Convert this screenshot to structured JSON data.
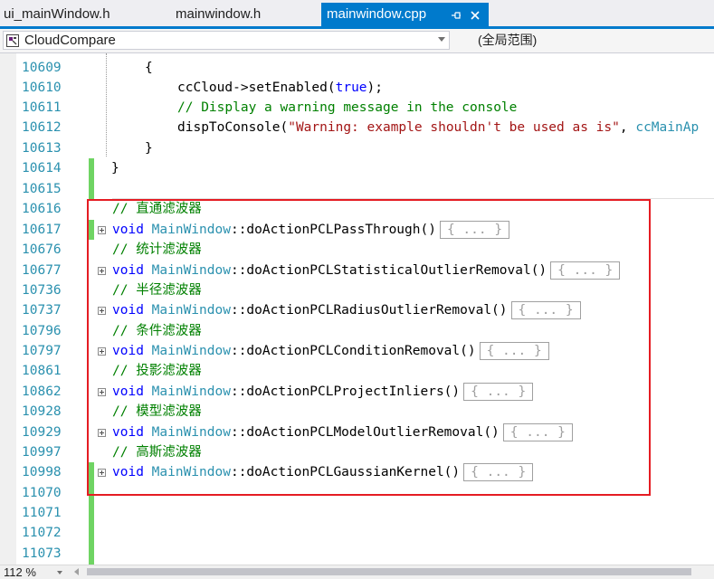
{
  "tabs": [
    {
      "label": "ui_mainWindow.h",
      "active": false
    },
    {
      "label": "mainwindow.h",
      "active": false
    },
    {
      "label": "mainwindow.cpp",
      "active": true
    }
  ],
  "tab_icons": {
    "pin": "pin-icon",
    "close": "close-icon"
  },
  "nav": {
    "scope": "CloudCompare",
    "member": "(全局范围)"
  },
  "zoom": "112 %",
  "line_numbers": [
    "10609",
    "10610",
    "10611",
    "10612",
    "10613",
    "10614",
    "10615",
    "10616",
    "10617",
    "10676",
    "10677",
    "10736",
    "10737",
    "10796",
    "10797",
    "10861",
    "10862",
    "10928",
    "10929",
    "10997",
    "10998",
    "11070",
    "11071",
    "11072",
    "11073"
  ],
  "code": {
    "l0": "{",
    "l1_obj": "ccCloud->setEnabled(",
    "l1_kw": "true",
    "l1_end": ");",
    "l2": "// Display a warning message in the console",
    "l3_fn": "dispToConsole(",
    "l3_str": "\"Warning: example shouldn't be used as is\"",
    "l3_sep": ", ",
    "l3_type": "ccMainAp",
    "l4": "}",
    "l5": "}",
    "collapsed": "{ ... }",
    "void": "void",
    "class": "MainWindow",
    "functions": [
      {
        "comment": "// 直通滤波器",
        "name": "::doActionPCLPassThrough()"
      },
      {
        "comment": "// 统计滤波器",
        "name": "::doActionPCLStatisticalOutlierRemoval()"
      },
      {
        "comment": "// 半径滤波器",
        "name": "::doActionPCLRadiusOutlierRemoval()"
      },
      {
        "comment": "// 条件滤波器",
        "name": "::doActionPCLConditionRemoval()"
      },
      {
        "comment": "// 投影滤波器",
        "name": "::doActionPCLProjectInliers()"
      },
      {
        "comment": "// 模型滤波器",
        "name": "::doActionPCLModelOutlierRemoval()"
      },
      {
        "comment": "// 高斯滤波器",
        "name": "::doActionPCLGaussianKernel()"
      }
    ]
  },
  "colors": {
    "accent": "#007acc",
    "keyword": "#0000ff",
    "type": "#2b91af",
    "comment": "#008000",
    "string": "#a31515",
    "highlight_box": "#e51c23",
    "change_bar": "#6fd463"
  }
}
